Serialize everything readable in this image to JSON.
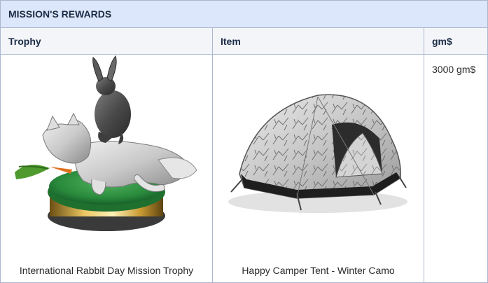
{
  "rewards": {
    "title": "MISSION'S REWARDS",
    "columns": {
      "trophy": "Trophy",
      "item": "Item",
      "currency": "gm$"
    },
    "row": {
      "trophy_name": "International Rabbit Day Mission Trophy",
      "item_name": "Happy Camper Tent - Winter Camo",
      "currency_amount": "3000 gm$"
    }
  }
}
